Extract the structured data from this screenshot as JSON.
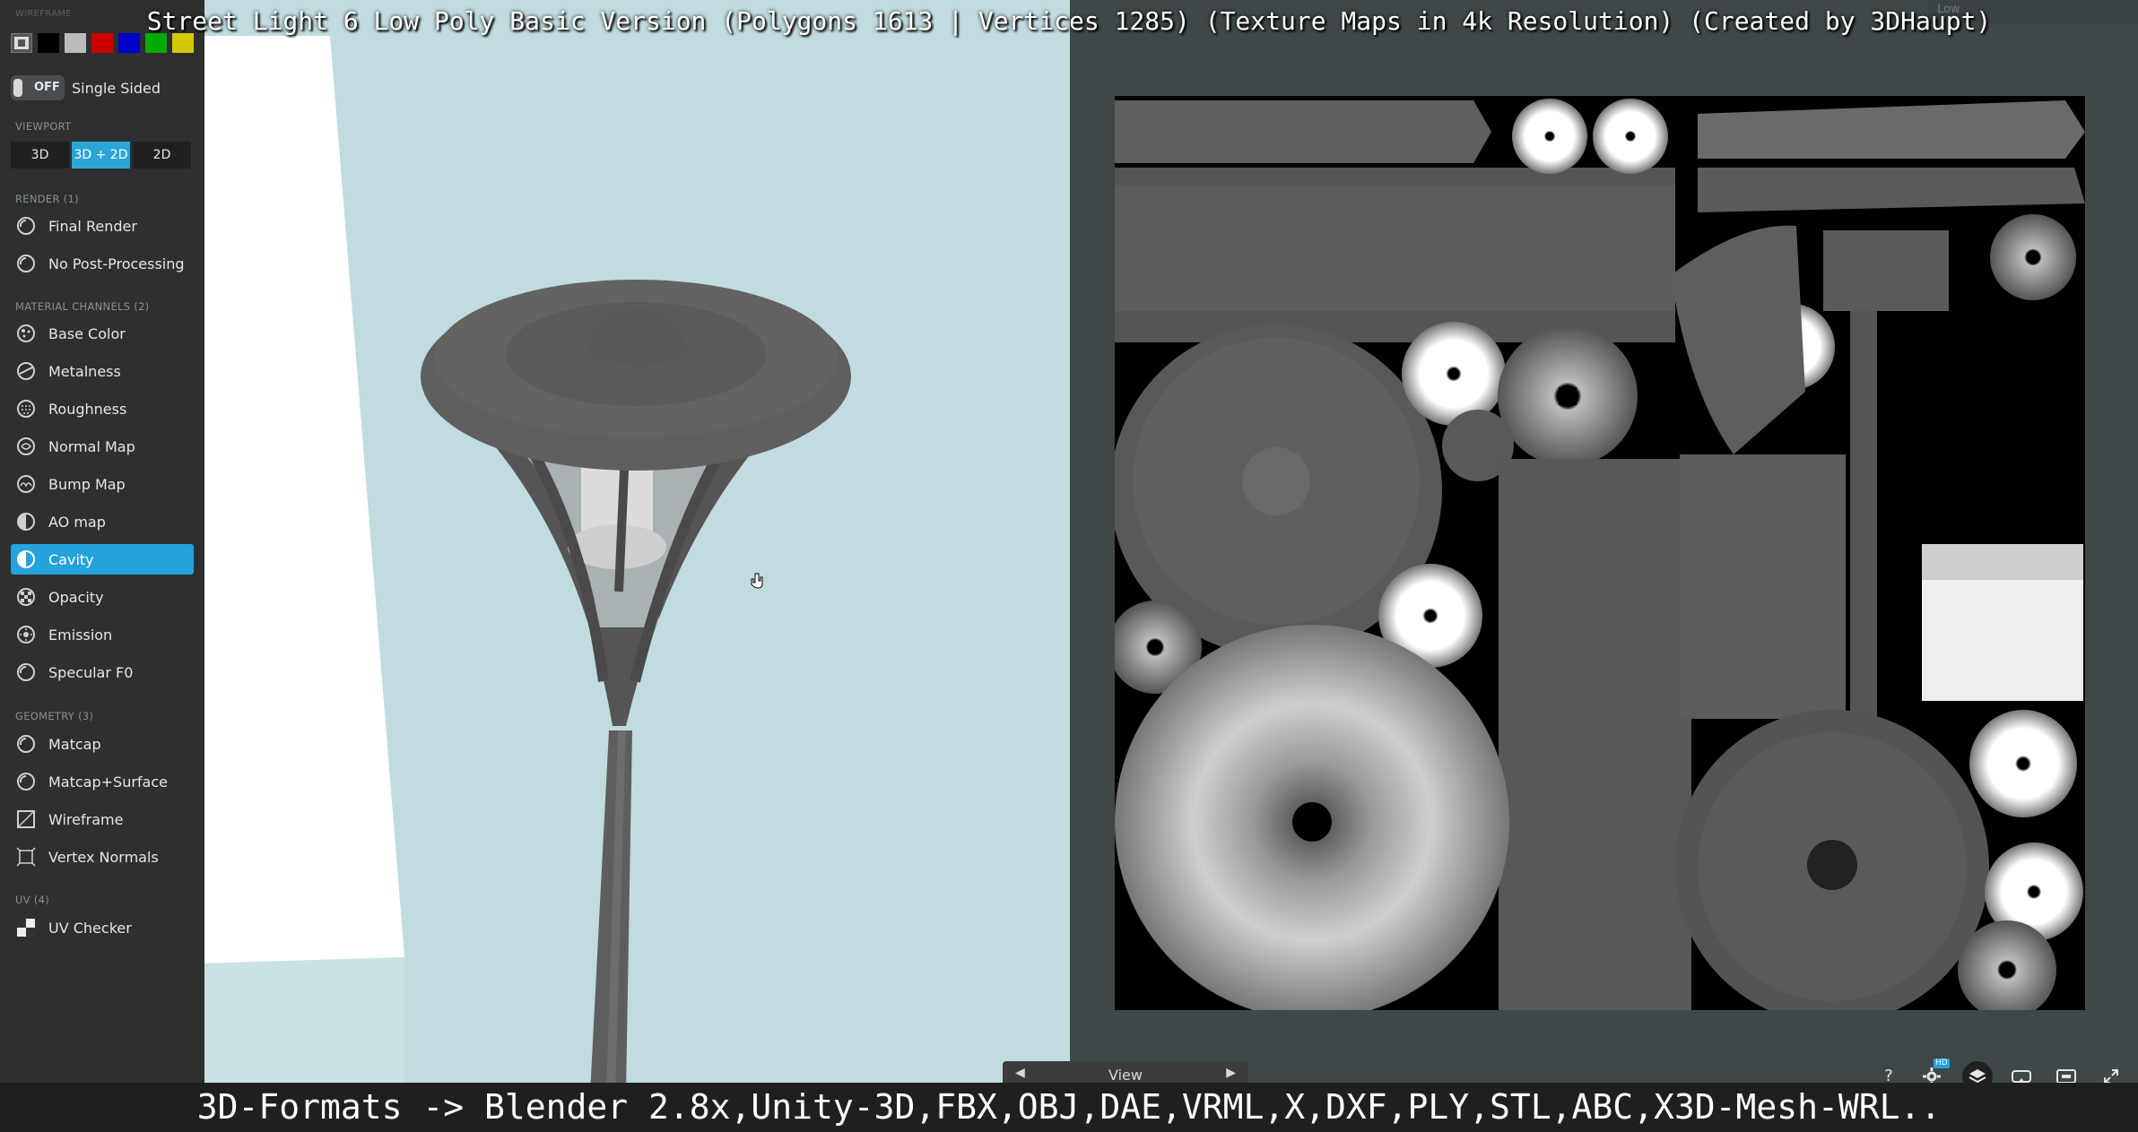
{
  "title": "Street Light 6 Low Poly Basic Version (Polygons 1613 | Vertices 1285) (Texture Maps in 4k Resolution) (Created by 3DHaupt)",
  "caption": "3D-Formats -> Blender 2.8x,Unity-3D,FBX,OBJ,DAE,VRML,X,DXF,PLY,STL,ABC,X3D-Mesh-WRL..",
  "top_right": {
    "value": "Low"
  },
  "sidebar": {
    "wireframe_label": "WIREFRAME",
    "wireframe_colors": [
      "#000000",
      "#bbbbbb",
      "#cc0000",
      "#0000cc",
      "#00aa00",
      "#d4c800"
    ],
    "single_sided": {
      "state": "OFF",
      "label": "Single Sided"
    },
    "viewport": {
      "label": "VIEWPORT",
      "options": [
        "3D",
        "3D + 2D",
        "2D"
      ],
      "selected": "3D + 2D"
    },
    "render": {
      "label": "RENDER (1)",
      "items": [
        "Final Render",
        "No Post-Processing"
      ]
    },
    "material": {
      "label": "MATERIAL CHANNELS (2)",
      "items": [
        "Base Color",
        "Metalness",
        "Roughness",
        "Normal Map",
        "Bump Map",
        "AO map",
        "Cavity",
        "Opacity",
        "Emission",
        "Specular F0"
      ],
      "selected": "Cavity"
    },
    "geometry": {
      "label": "GEOMETRY (3)",
      "items": [
        "Matcap",
        "Matcap+Surface",
        "Wireframe",
        "Vertex Normals"
      ]
    },
    "uv": {
      "label": "UV (4)",
      "items": [
        "UV Checker"
      ]
    }
  },
  "toolbar": {
    "view_label": "View",
    "help_label": "?",
    "hd_badge": "HD"
  },
  "colors": {
    "accent": "#23a2dc",
    "sidebar_bg": "#2e2f30",
    "viewport_3d_bg": "#c1dcdf",
    "viewport_2d_bg": "#3f4848"
  }
}
